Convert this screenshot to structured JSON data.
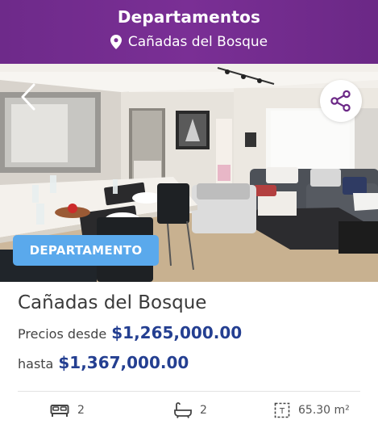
{
  "header": {
    "title": "Departamentos",
    "location": "Cañadas del Bosque",
    "background": "#7a2f95",
    "icons": {
      "location": "map-pin-icon"
    }
  },
  "listing": {
    "badge": "DEPARTAMENTO",
    "badge_color": "#5aa9ec",
    "name": "Cañadas del Bosque",
    "price_from_label": "Precios desde",
    "price_from": "$1,265,000.00",
    "price_to_label": "hasta",
    "price_to": "$1,367,000.00",
    "price_color": "#243f91"
  },
  "features": {
    "bedrooms": {
      "icon": "bed-icon",
      "value": "2"
    },
    "bathrooms": {
      "icon": "bathtub-icon",
      "value": "2"
    },
    "area": {
      "icon": "area-icon",
      "value": "65.30 m²"
    }
  },
  "controls": {
    "back_icon": "chevron-left-icon",
    "share_icon": "share-icon"
  }
}
